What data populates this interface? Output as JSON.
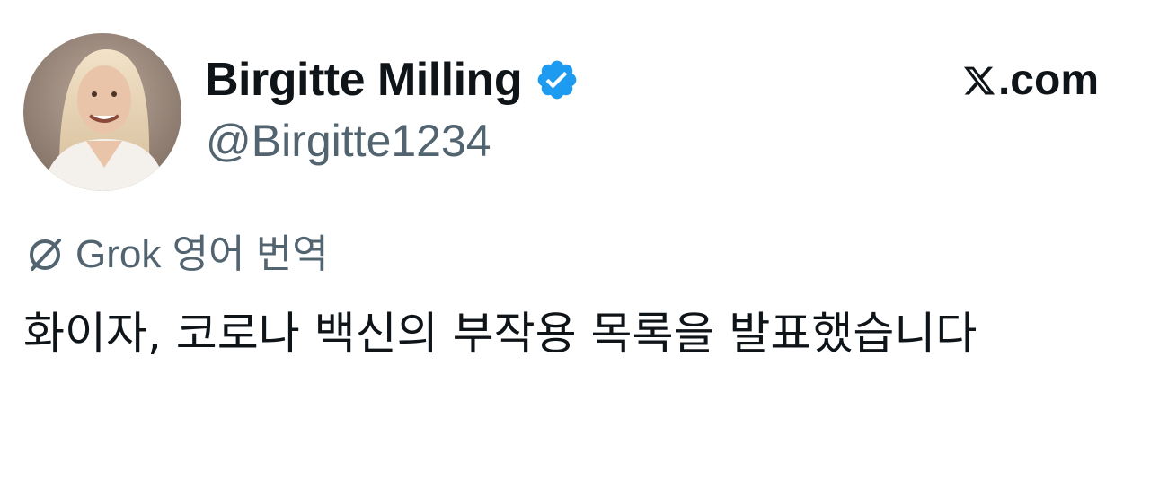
{
  "author": {
    "display_name": "Birgitte Milling",
    "handle": "@Birgitte1234",
    "verified_icon": "verified-badge-icon",
    "avatar_icon": "profile-photo"
  },
  "brand": {
    "label": ".com",
    "icon": "x-logo-icon"
  },
  "translation": {
    "icon": "grok-icon",
    "label": "Grok 영어 번역"
  },
  "post": {
    "text": "화이자, 코로나 백신의 부작용 목록을 발표했습니다"
  },
  "colors": {
    "text_primary": "#0f1419",
    "text_secondary": "#536471",
    "verified_blue": "#1d9bf0",
    "background": "#ffffff"
  }
}
